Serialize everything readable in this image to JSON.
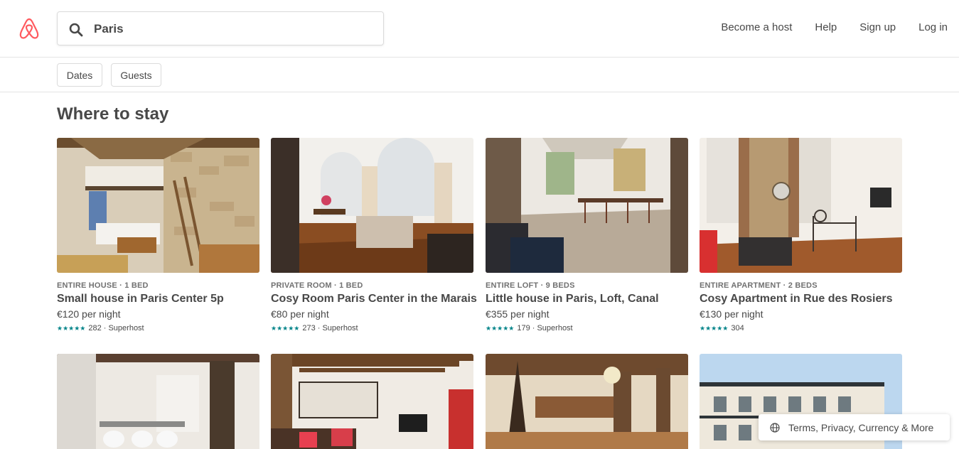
{
  "header": {
    "logo": "airbnb-logo-icon",
    "search": {
      "value": "Paris",
      "icon": "search-icon"
    },
    "nav": [
      "Become a host",
      "Help",
      "Sign up",
      "Log in"
    ]
  },
  "filters": {
    "dates": "Dates",
    "guests": "Guests"
  },
  "main": {
    "heading": "Where to stay",
    "listings": [
      {
        "type": "ENTIRE HOUSE · 1 BED",
        "title": "Small house in Paris Center 5p",
        "price": "€120 per night",
        "rating": "282 · Superhost"
      },
      {
        "type": "PRIVATE ROOM · 1 BED",
        "title": "Cosy Room Paris Center in the Marais",
        "price": "€80 per night",
        "rating": "273 · Superhost"
      },
      {
        "type": "ENTIRE LOFT · 9 BEDS",
        "title": "Little house in Paris, Loft, Canal",
        "price": "€355 per night",
        "rating": "179 · Superhost"
      },
      {
        "type": "ENTIRE APARTMENT · 2 BEDS",
        "title": "Cosy Apartment in Rue des Rosiers",
        "price": "€130 per night",
        "rating": "304"
      }
    ],
    "stars": "★★★★★"
  },
  "footer": {
    "label": "Terms, Privacy, Currency & More",
    "icon": "globe-icon"
  },
  "colors": {
    "accent": "#FF5A5F",
    "star": "#008489",
    "text": "#484848",
    "muted": "#717171"
  }
}
